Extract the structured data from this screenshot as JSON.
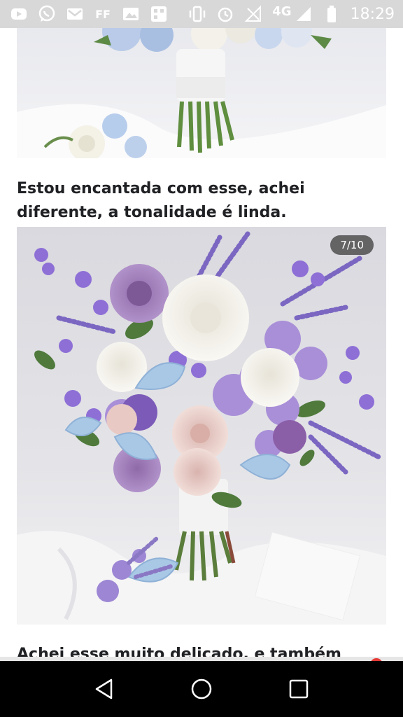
{
  "status_bar": {
    "network": "4G",
    "ff_label": "FF",
    "time": "18:29",
    "left_icons": [
      "youtube-icon",
      "whatsapp-icon",
      "gmail-icon",
      "ff-icon",
      "gallery-icon",
      "app-grid-icon"
    ],
    "right_icons": [
      "vibrate-icon",
      "alarm-icon",
      "signal-empty-icon",
      "signal-icon",
      "battery-icon"
    ]
  },
  "post": {
    "caption_1": "Estou encantada com esse, achei diferente, a tonalidade é linda.",
    "image_counter": "7/10",
    "caption_2": "Achei esse muito delicado, e também"
  },
  "colors": {
    "lavender": "#8e6fd6",
    "lilac": "#a98fd8",
    "light_blue": "#a9c8e6",
    "white_peony": "#f4f2ee",
    "greenery": "#4f7a3c"
  },
  "nav_bar": {
    "buttons": [
      "back-icon",
      "home-icon",
      "recents-icon"
    ]
  }
}
